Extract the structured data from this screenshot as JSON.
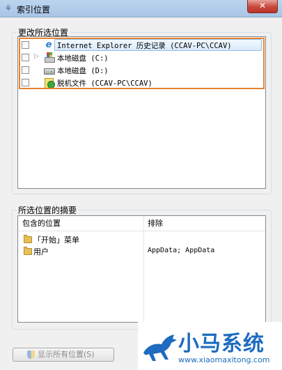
{
  "window": {
    "title": "索引位置",
    "close_label": "✕"
  },
  "change_section": {
    "heading": "更改所选位置",
    "items": [
      {
        "label": "Internet Explorer 历史记录 (CCAV-PC\\CCAV)",
        "icon": "ie-icon",
        "checked": false,
        "expandable": false
      },
      {
        "label": "本地磁盘 (C:)",
        "icon": "system-drive-icon",
        "checked": false,
        "expandable": true
      },
      {
        "label": "本地磁盘 (D:)",
        "icon": "drive-icon",
        "checked": false,
        "expandable": false
      },
      {
        "label": "脱机文件 (CCAV-PC\\CCAV)",
        "icon": "offline-files-icon",
        "checked": false,
        "expandable": false
      }
    ]
  },
  "summary_section": {
    "heading": "所选位置的摘要",
    "columns": [
      "包含的位置",
      "排除"
    ],
    "rows": [
      {
        "location": "「开始」菜单",
        "exclude": ""
      },
      {
        "location": "用户",
        "exclude": "AppData; AppData"
      }
    ]
  },
  "buttons": {
    "show_all": "显示所有位置(S)"
  },
  "watermark": {
    "brand": "小马系统",
    "url": "www.xiaomaxitong.com"
  },
  "colors": {
    "highlight": "#e8822e",
    "selection": "#d9ebfb",
    "brand": "#1e6bbf"
  }
}
